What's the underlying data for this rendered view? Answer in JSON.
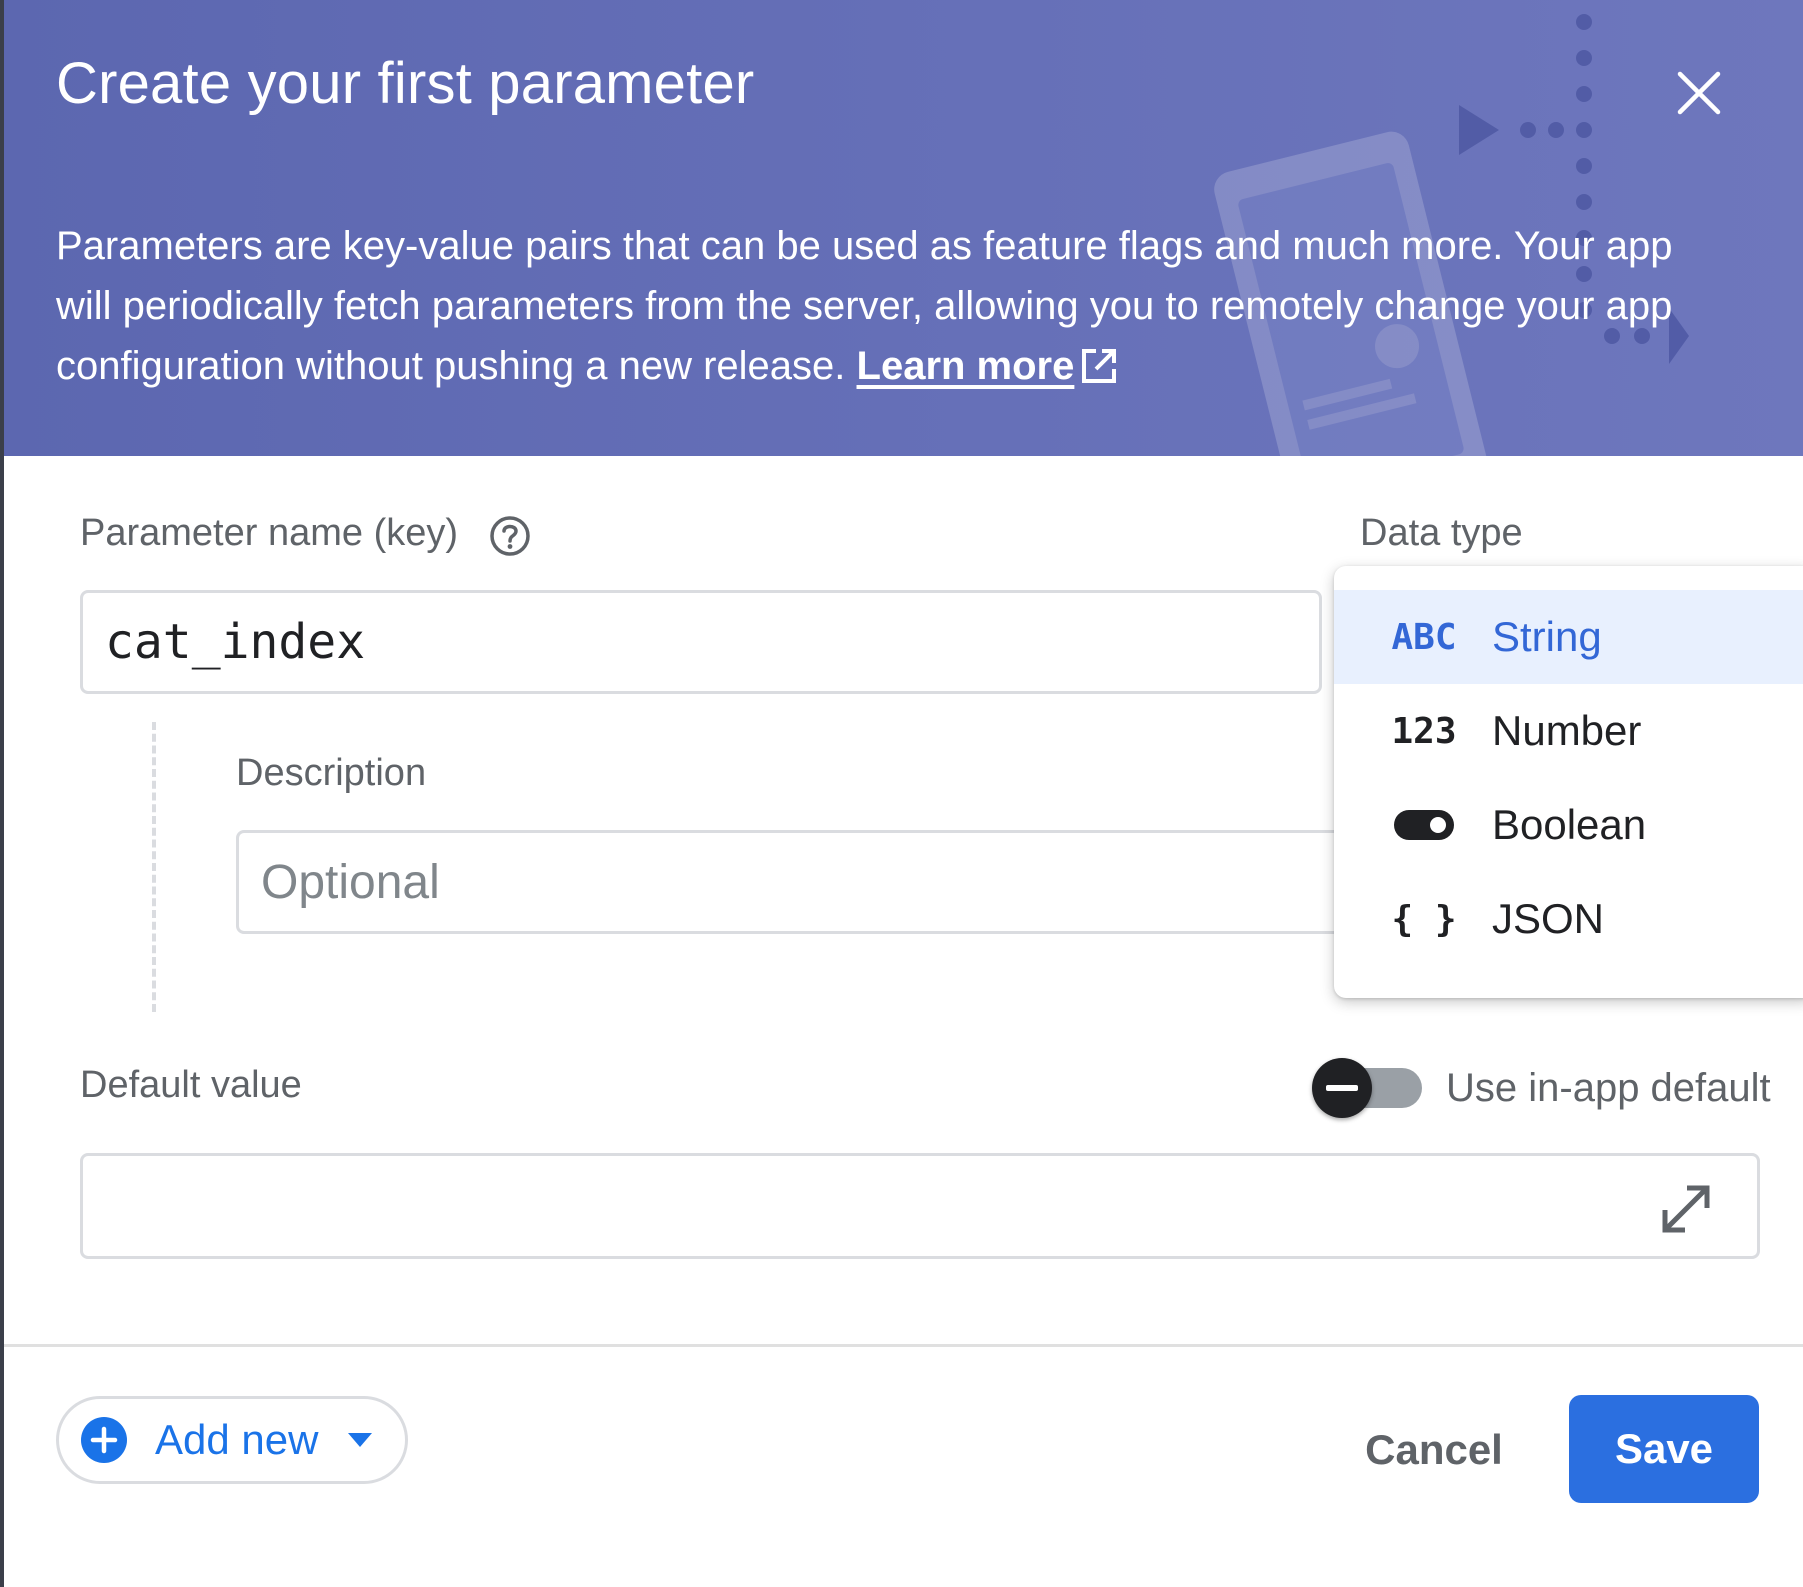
{
  "dialog": {
    "title": "Create your first parameter",
    "intro_text": "Parameters are key-value pairs that can be used as feature flags and much more. Your app will periodically fetch parameters from the server, allowing you to remotely change your app configuration without pushing a new release. ",
    "learn_more_label": "Learn more"
  },
  "form": {
    "parameter_name_label": "Parameter name (key)",
    "parameter_name_value": "cat_index",
    "data_type_label": "Data type",
    "description_label": "Description",
    "description_placeholder": "Optional",
    "default_value_label": "Default value",
    "default_value_value": "",
    "use_in_app_default_label": "Use in-app default"
  },
  "data_type_menu": {
    "selected": "String",
    "options": [
      {
        "icon_text": "ABC",
        "label": "String",
        "icon": "abc-icon"
      },
      {
        "icon_text": "123",
        "label": "Number",
        "icon": "number-icon"
      },
      {
        "icon_text": "",
        "label": "Boolean",
        "icon": "toggle-icon"
      },
      {
        "icon_text": "{ }",
        "label": "JSON",
        "icon": "braces-icon"
      }
    ]
  },
  "footer": {
    "add_new_label": "Add new",
    "cancel_label": "Cancel",
    "save_label": "Save"
  },
  "colors": {
    "header_bg": "#6670b8",
    "accent": "#1a73e8",
    "save_bg": "#2b6fe0",
    "selected_bg": "#e8f0fe"
  }
}
